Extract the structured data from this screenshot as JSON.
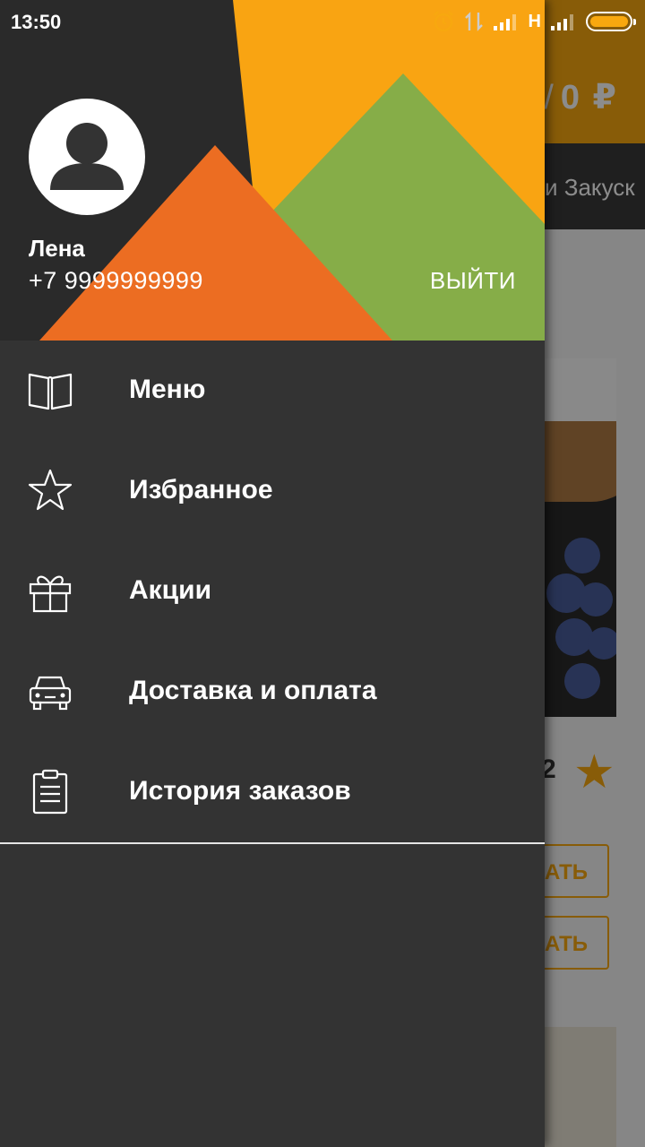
{
  "status_bar": {
    "time": "13:50",
    "network_label": "H",
    "icons": [
      "alarm-icon",
      "data-transfer-icon",
      "signal-icon",
      "signal-icon",
      "battery-icon"
    ]
  },
  "background_app": {
    "cart_total": "0 ₽",
    "visible_tab": "и Закуск",
    "rating_fragment": "2",
    "button_fragment_1": "АТЬ",
    "button_fragment_2": "АТЬ"
  },
  "drawer": {
    "user": {
      "name": "Лена",
      "phone": "+7 9999999999"
    },
    "logout_label": "ВЫЙТИ",
    "menu": [
      {
        "label": "Меню",
        "icon": "book-icon"
      },
      {
        "label": "Избранное",
        "icon": "star-icon"
      },
      {
        "label": "Акции",
        "icon": "gift-icon"
      },
      {
        "label": "Доставка и оплата",
        "icon": "car-icon"
      },
      {
        "label": "История заказов",
        "icon": "clipboard-icon"
      }
    ]
  },
  "colors": {
    "accent_orange": "#f8a80f",
    "header_orange": "#f07a22",
    "header_green": "#8ab04a",
    "drawer_bg": "#333333"
  }
}
